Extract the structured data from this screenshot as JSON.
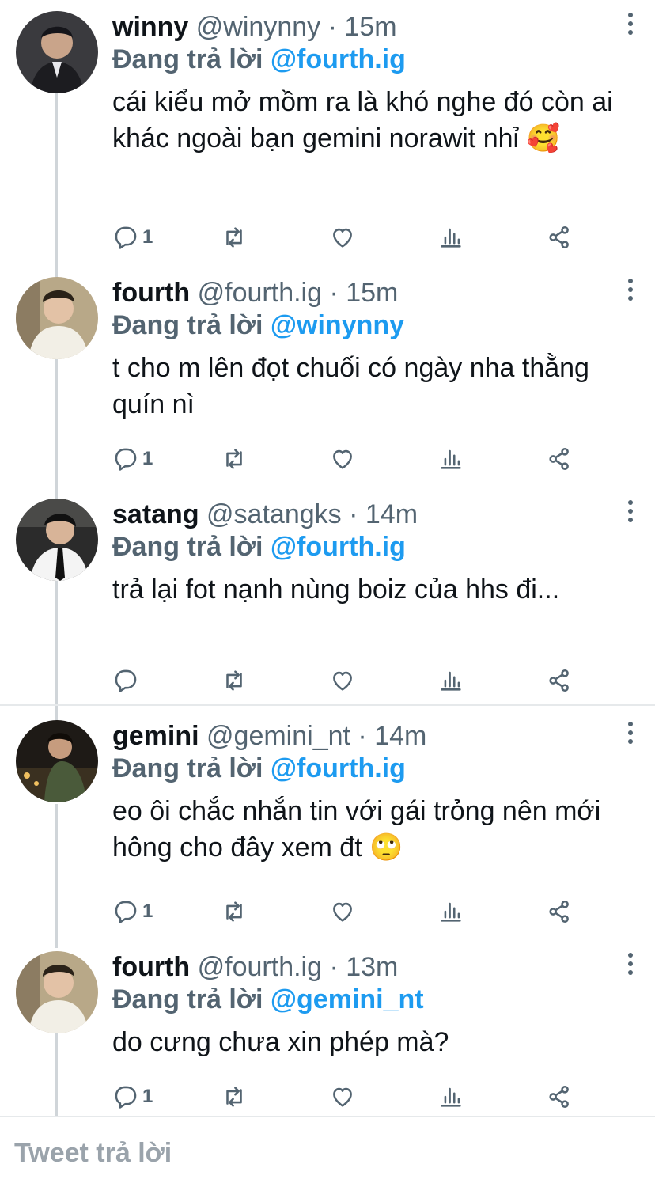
{
  "tweets": [
    {
      "name": "winny",
      "handle": "@winynny",
      "time": "· 15m",
      "replying_prefix": "Đang trả lời",
      "replying_to": "@fourth.ig",
      "text": "cái kiểu mở mồm ra là khó nghe đó còn ai khác ngoài bạn gemini norawit nhỉ 🥰",
      "reply_count": "1",
      "retweet_count": "",
      "like_count": ""
    },
    {
      "name": "fourth",
      "handle": "@fourth.ig",
      "time": "· 15m",
      "replying_prefix": "Đang trả lời",
      "replying_to": "@winynny",
      "text": "t cho m lên đọt chuối có ngày nha thằng quín nì",
      "reply_count": "1",
      "retweet_count": "",
      "like_count": ""
    },
    {
      "name": "satang",
      "handle": "@satangks",
      "time": "· 14m",
      "replying_prefix": "Đang trả lời",
      "replying_to": "@fourth.ig",
      "text": "trả lại fot nạnh nùng boiz của hhs đi...",
      "reply_count": "",
      "retweet_count": "",
      "like_count": ""
    },
    {
      "name": "gemini",
      "handle": "@gemini_nt",
      "time": "· 14m",
      "replying_prefix": "Đang trả lời",
      "replying_to": "@fourth.ig",
      "text": "eo ôi chắc nhắn tin với gái trỏng nên mới hông cho đây xem đt 🙄",
      "reply_count": "1",
      "retweet_count": "",
      "like_count": ""
    },
    {
      "name": "fourth",
      "handle": "@fourth.ig",
      "time": "· 13m",
      "replying_prefix": "Đang trả lời",
      "replying_to": "@gemini_nt",
      "text": "do cưng chưa xin phép mà?",
      "reply_count": "1",
      "retweet_count": "",
      "like_count": ""
    }
  ],
  "reply_bar": {
    "placeholder": "Tweet trả lời"
  },
  "colors": {
    "accent": "#1d9bf0",
    "muted": "#536471",
    "thread_line": "#d0d5d9"
  },
  "icons": [
    "reply-icon",
    "retweet-icon",
    "like-icon",
    "analytics-icon",
    "share-icon",
    "more-options-icon"
  ]
}
